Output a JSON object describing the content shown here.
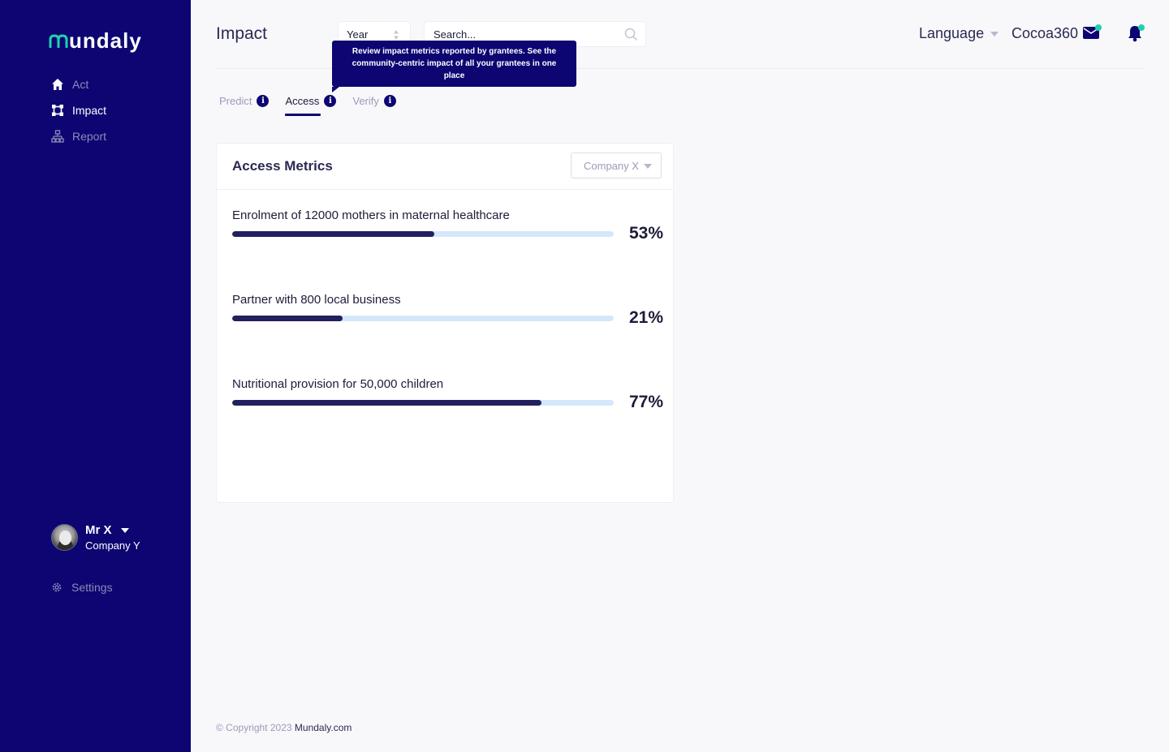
{
  "app": {
    "logo_text": "undaly",
    "brand_color": "#0d0672",
    "accent_color": "#1ed1b1"
  },
  "sidebar": {
    "items": [
      {
        "label": "Act",
        "icon": "home-icon",
        "active": false
      },
      {
        "label": "Impact",
        "icon": "impact-nodes-icon",
        "active": true
      },
      {
        "label": "Report",
        "icon": "report-hierarchy-icon",
        "active": false
      }
    ],
    "profile": {
      "name": "Mr X",
      "company": "Company Y"
    },
    "settings_label": "Settings"
  },
  "header": {
    "title": "Impact",
    "year_label": "Year",
    "search_placeholder": "Search...",
    "language_label": "Language",
    "org_name": "Cocoa360"
  },
  "tooltip": {
    "text": "Review impact metrics reported by grantees. See the community-centric impact of all your grantees in one place"
  },
  "tabs": [
    {
      "label": "Predict",
      "active": false
    },
    {
      "label": "Access",
      "active": true
    },
    {
      "label": "Verify",
      "active": false
    }
  ],
  "card": {
    "title": "Access Metrics",
    "company_filter": "Company X",
    "metrics": [
      {
        "label": "Enrolment of 12000 mothers in maternal healthcare",
        "percent_text": "53%",
        "progress": 0.53
      },
      {
        "label": "Partner with 800 local business",
        "percent_text": "21%",
        "progress": 0.29
      },
      {
        "label": "Nutritional provision for 50,000 children",
        "percent_text": "77%",
        "progress": 0.81
      }
    ]
  },
  "footer": {
    "copyright": "© Copyright 2023",
    "link": "Mundaly.com"
  }
}
